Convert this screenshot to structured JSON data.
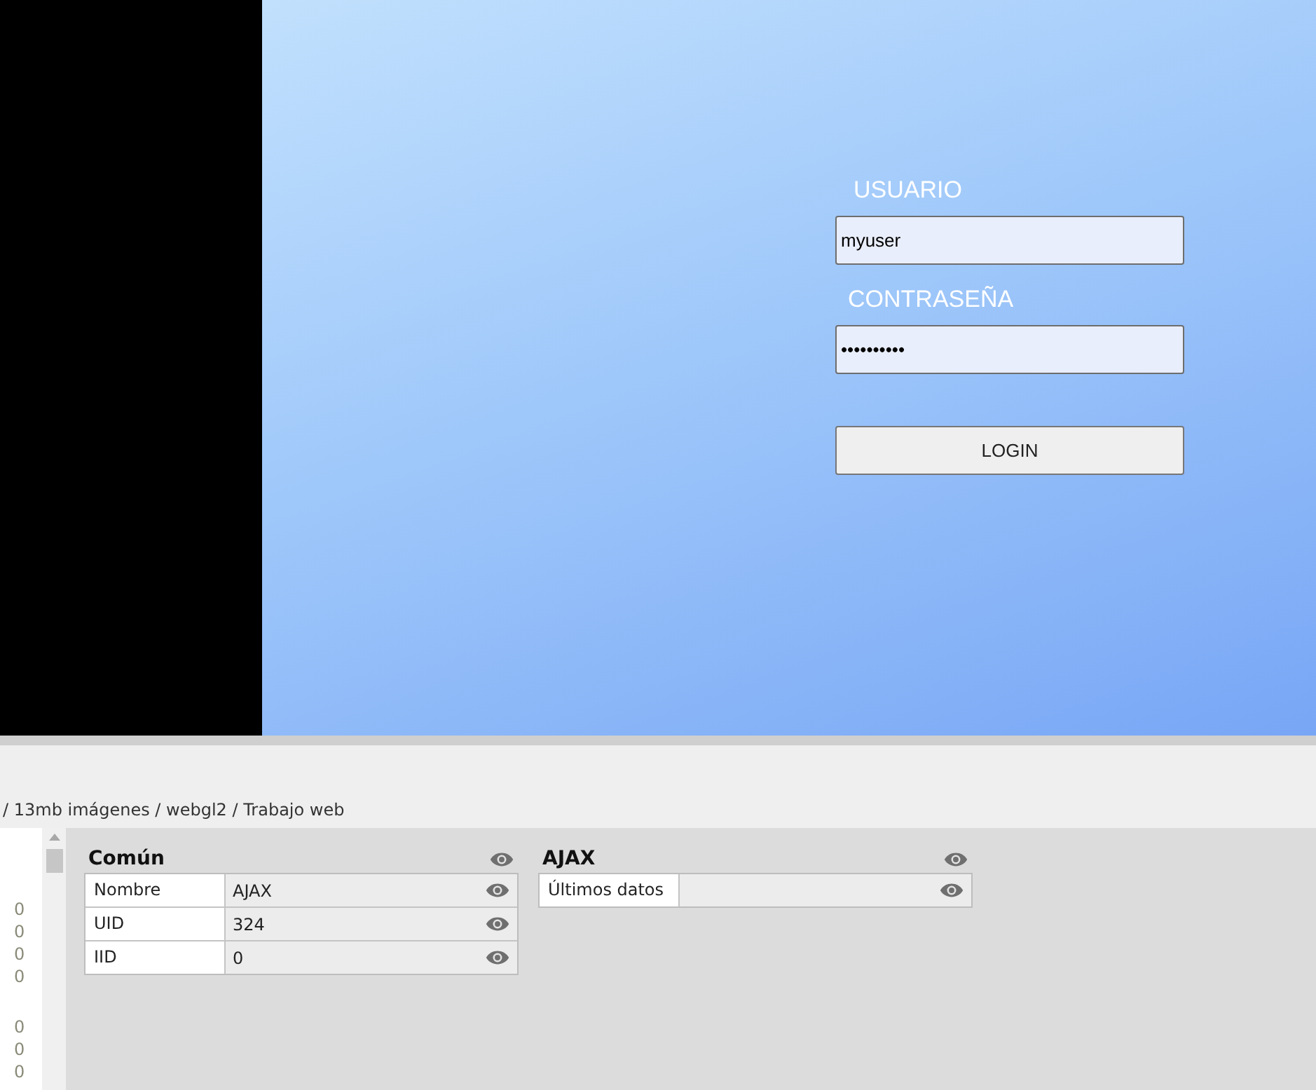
{
  "login": {
    "user_label": "USUARIO",
    "user_value": "myuser",
    "password_label": "CONTRASEÑA",
    "password_value": "••••••••••",
    "button": "LOGIN"
  },
  "breadcrumb": "/ 13mb imágenes / webgl2 / Trabajo web",
  "left_column": [
    [
      "0",
      "0",
      "0",
      "0"
    ],
    [
      "0",
      "0",
      "0"
    ]
  ],
  "panels": [
    {
      "title": "Común",
      "rows": [
        {
          "label": "Nombre",
          "value": "AJAX"
        },
        {
          "label": "UID",
          "value": "324"
        },
        {
          "label": "IID",
          "value": "0"
        }
      ]
    },
    {
      "title": "AJAX",
      "rows": [
        {
          "label": "Últimos datos",
          "value": ""
        }
      ]
    }
  ]
}
